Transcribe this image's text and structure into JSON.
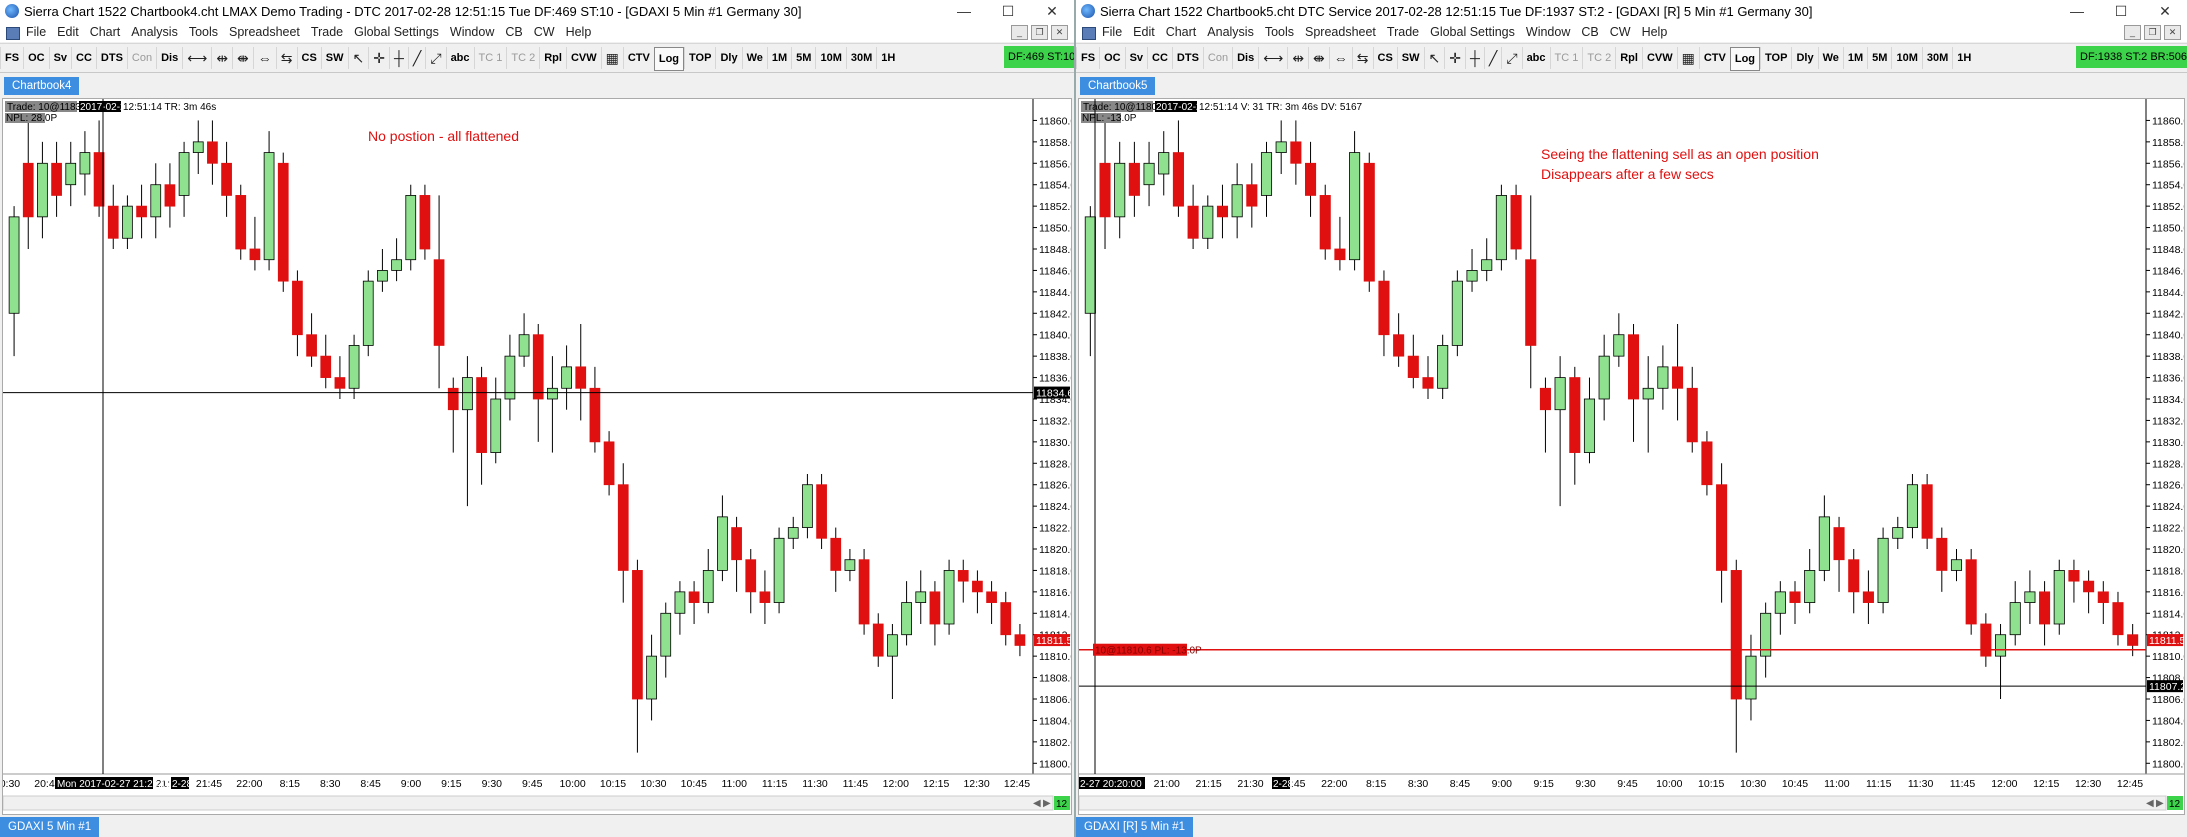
{
  "left": {
    "title": "Sierra Chart 1522 Chartbook4.cht  LMAX Demo Trading - DTC 2017-02-28  12:51:15 Tue  DF:469  ST:10 - [GDAXI  5 Min  #1 Germany 30]",
    "status": "DF:469 ST:10",
    "tab": "Chartbook4",
    "bottom_tab": "GDAXI  5 Min   #1",
    "info_trade": "Trade: 10@11834.6",
    "info_date": "2017-02-28",
    "info_rest": " 12:51:14 TR: 3m 46s",
    "npl": "NPL: 28.0P",
    "annotation": "No postion - all flattened",
    "crosshair_price": "11834.6",
    "last_price": "11811.5",
    "crosshair_time": "Mon 2017-02-27  21:20:00",
    "date_marker": "2-28",
    "scroll_num": "12"
  },
  "right": {
    "title": "Sierra Chart 1522 Chartbook5.cht  DTC Service 2017-02-28  12:51:15 Tue  DF:1937  ST:2 - [GDAXI [R]  5 Min  #1 Germany 30]",
    "status": "DF:1938  ST:2  BR:506",
    "tab": "Chartbook5",
    "bottom_tab": "GDAXI [R]  5 Min   #1",
    "info_trade": "Trade: 10@11807.2",
    "info_date": "2017-02-28",
    "info_rest": " 12:51:14 V: 31 TR: 3m 46s DV: 5167",
    "npl": "NPL: -13.0P",
    "annotation1": "Seeing the flattening  sell as an open position",
    "annotation2": "Disappears after a few secs",
    "position_label": "10@11810.6 PL: -13.0P",
    "crosshair_price": "11807.2",
    "last_price": "11811.5",
    "crosshair_time": "2-27  20:20:00",
    "date_marker": "2-28",
    "scroll_num": "12"
  },
  "menu": [
    "File",
    "Edit",
    "Chart",
    "Analysis",
    "Tools",
    "Spreadsheet",
    "Trade",
    "Global Settings",
    "Window",
    "CB",
    "CW",
    "Help"
  ],
  "toolbar_a": [
    "FS",
    "OC",
    "Sv",
    "CC",
    "DTS",
    "Con",
    "Dis"
  ],
  "toolbar_b": [
    "CS",
    "SW"
  ],
  "toolbar_c": [
    "abc",
    "TC 1",
    "TC 2",
    "Rpl",
    "CVW"
  ],
  "toolbar_d": [
    "CTV",
    "Log",
    "TOP",
    "Dly",
    "We",
    "1M",
    "5M",
    "10M",
    "30M",
    "1H"
  ],
  "price_labels": [
    "11860.0",
    "11858.0",
    "11856.0",
    "11854.0",
    "11852.0",
    "11850.0",
    "11848.0",
    "11846.0",
    "11844.0",
    "11842.0",
    "11840.0",
    "11838.0",
    "11836.0",
    "11834.0",
    "11832.0",
    "11830.0",
    "11828.0",
    "11826.0",
    "11824.0",
    "11822.0",
    "11820.0",
    "11818.0",
    "11816.0",
    "11814.0",
    "11812.0",
    "11810.0",
    "11808.0",
    "11806.0",
    "11804.0",
    "11802.0",
    "11800.0"
  ],
  "time_labels": [
    "20:30",
    "20:45",
    "21:00",
    "21:15",
    "21:30",
    "21:45",
    "22:00",
    "8:15",
    "8:30",
    "8:45",
    "9:00",
    "9:15",
    "9:30",
    "9:45",
    "10:00",
    "10:15",
    "10:30",
    "10:45",
    "11:00",
    "11:15",
    "11:30",
    "11:45",
    "12:00",
    "12:15",
    "12:30",
    "12:45"
  ],
  "colors": {
    "up": "#8fe08f",
    "down": "#e01010",
    "accent": "#3d8ee0",
    "status": "#3cd24a",
    "annotation": "#e01010"
  },
  "chart_data": {
    "type": "candlestick",
    "title": "GDAXI 5 Min",
    "ylim": [
      11799,
      11862
    ],
    "x_labels_note": "5-minute bars",
    "bars": [
      [
        11842,
        11851,
        11852,
        11838
      ],
      [
        11856,
        11851,
        11860,
        11848
      ],
      [
        11851,
        11856,
        11858,
        11849
      ],
      [
        11856,
        11853,
        11858,
        11851
      ],
      [
        11854,
        11856,
        11858,
        11852
      ],
      [
        11855,
        11857,
        11859,
        11853
      ],
      [
        11857,
        11852,
        11860,
        11851
      ],
      [
        11852,
        11849,
        11854,
        11848
      ],
      [
        11849,
        11852,
        11853,
        11848
      ],
      [
        11852,
        11851,
        11854,
        11849
      ],
      [
        11851,
        11854,
        11856,
        11849
      ],
      [
        11854,
        11852,
        11856,
        11850
      ],
      [
        11853,
        11857,
        11858,
        11851
      ],
      [
        11857,
        11858,
        11860,
        11855
      ],
      [
        11858,
        11856,
        11860,
        11854
      ],
      [
        11856,
        11853,
        11858,
        11851
      ],
      [
        11853,
        11848,
        11854,
        11847
      ],
      [
        11848,
        11847,
        11851,
        11846
      ],
      [
        11847,
        11857,
        11859,
        11846
      ],
      [
        11856,
        11845,
        11857,
        11844
      ],
      [
        11845,
        11840,
        11846,
        11838
      ],
      [
        11840,
        11838,
        11842,
        11837
      ],
      [
        11838,
        11836,
        11840,
        11835
      ],
      [
        11836,
        11835,
        11838,
        11834
      ],
      [
        11835,
        11839,
        11840,
        11834
      ],
      [
        11839,
        11845,
        11846,
        11838
      ],
      [
        11845,
        11846,
        11848,
        11844
      ],
      [
        11846,
        11847,
        11849,
        11845
      ],
      [
        11847,
        11853,
        11854,
        11846
      ],
      [
        11853,
        11848,
        11854,
        11847
      ],
      [
        11847,
        11839,
        11853,
        11835
      ],
      [
        11835,
        11833,
        11836,
        11829
      ],
      [
        11833,
        11836,
        11838,
        11824
      ],
      [
        11836,
        11829,
        11837,
        11826
      ],
      [
        11829,
        11834,
        11836,
        11828
      ],
      [
        11834,
        11838,
        11840,
        11832
      ],
      [
        11838,
        11840,
        11842,
        11837
      ],
      [
        11840,
        11834,
        11841,
        11830
      ],
      [
        11834,
        11835,
        11838,
        11829
      ],
      [
        11835,
        11837,
        11839,
        11833
      ],
      [
        11837,
        11835,
        11841,
        11832
      ],
      [
        11835,
        11830,
        11837,
        11829
      ],
      [
        11830,
        11826,
        11831,
        11825
      ],
      [
        11826,
        11818,
        11828,
        11815
      ],
      [
        11818,
        11806,
        11819,
        11801
      ],
      [
        11806,
        11810,
        11812,
        11804
      ],
      [
        11810,
        11814,
        11815,
        11808
      ],
      [
        11814,
        11816,
        11817,
        11812
      ],
      [
        11816,
        11815,
        11817,
        11813
      ],
      [
        11815,
        11818,
        11820,
        11814
      ],
      [
        11818,
        11823,
        11825,
        11817
      ],
      [
        11822,
        11819,
        11823,
        11816
      ],
      [
        11819,
        11816,
        11820,
        11814
      ],
      [
        11816,
        11815,
        11818,
        11813
      ],
      [
        11815,
        11821,
        11822,
        11814
      ],
      [
        11821,
        11822,
        11823,
        11820
      ],
      [
        11822,
        11826,
        11827,
        11821
      ],
      [
        11826,
        11821,
        11827,
        11820
      ],
      [
        11821,
        11818,
        11822,
        11816
      ],
      [
        11818,
        11819,
        11820,
        11817
      ],
      [
        11819,
        11813,
        11820,
        11812
      ],
      [
        11813,
        11810,
        11814,
        11809
      ],
      [
        11810,
        11812,
        11813,
        11806
      ],
      [
        11812,
        11815,
        11817,
        11811
      ],
      [
        11815,
        11816,
        11818,
        11813
      ],
      [
        11816,
        11813,
        11817,
        11811
      ],
      [
        11813,
        11818,
        11819,
        11812
      ],
      [
        11818,
        11817,
        11819,
        11815
      ],
      [
        11817,
        11816,
        11818,
        11814
      ],
      [
        11816,
        11815,
        11817,
        11813
      ],
      [
        11815,
        11812,
        11816,
        11811
      ],
      [
        11812,
        11811,
        11813,
        11810
      ]
    ]
  }
}
